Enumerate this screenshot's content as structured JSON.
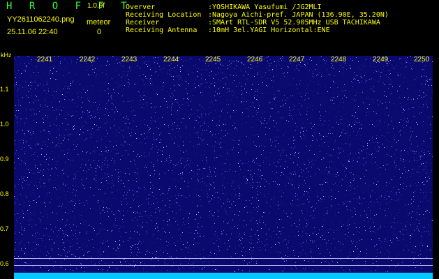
{
  "header": {
    "app_title": "H R O F F T",
    "version": "1.0.0f",
    "filename": "YY2611062240.png",
    "datetime": "25.11.06 22:40",
    "meteor_label": "meteor",
    "meteor_count": "0",
    "info": [
      {
        "key": "Overver",
        "value": ":YOSHIKAWA Yasufumi /JG2MLI"
      },
      {
        "key": "Receiving Location",
        "value": ":Nagoya Aichi-pref. JAPAN (136.90E, 35.20N)"
      },
      {
        "key": "Receiver",
        "value": ":SMArt RTL-SDR V5 52.905MHz USB TACHIKAWA"
      },
      {
        "key": "Receiving Antenna",
        "value": ":10mH 3el.YAGI Horizontal:ENE"
      }
    ]
  },
  "axis": {
    "y_unit": "kHz",
    "y_labels": [
      "1.1",
      "1.0",
      "0.9",
      "0.8",
      "0.7",
      "0.6"
    ],
    "x_labels": [
      "2241",
      "2242",
      "2243",
      "2244",
      "2245",
      "2246",
      "2247",
      "2248",
      "2249",
      "2250"
    ]
  },
  "colors": {
    "background": "#000000",
    "spectrogram": "#0a0a6e",
    "text": "#ffff00",
    "title": "#33ff33",
    "baseline": "#00c8ff"
  }
}
